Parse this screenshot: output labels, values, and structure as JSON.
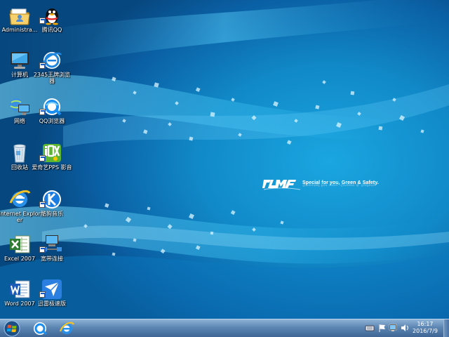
{
  "desktop": {
    "icons": [
      {
        "label": "Administra...",
        "icon": "user-folder-icon"
      },
      {
        "label": "腾讯QQ",
        "icon": "qq-penguin-icon"
      },
      {
        "label": "计算机",
        "icon": "computer-icon"
      },
      {
        "label": "2345王牌浏览器",
        "icon": "2345-browser-icon"
      },
      {
        "label": "网络",
        "icon": "network-icon"
      },
      {
        "label": "QQ浏览器",
        "icon": "qq-browser-icon"
      },
      {
        "label": "回收站",
        "icon": "recycle-bin-icon"
      },
      {
        "label": "爱奇艺PPS 影音",
        "icon": "iqiyi-pps-icon"
      },
      {
        "label": "Internet Explorer",
        "icon": "internet-explorer-icon"
      },
      {
        "label": "酷狗音乐",
        "icon": "kugou-music-icon"
      },
      {
        "label": "Excel 2007",
        "icon": "excel-icon"
      },
      {
        "label": "宽带连接",
        "icon": "broadband-connection-icon"
      },
      {
        "label": "Word 2007",
        "icon": "word-icon"
      },
      {
        "label": "迅雷极速版",
        "icon": "thunder-icon"
      }
    ]
  },
  "wallpaper": {
    "brand_text": "Special for you, Green & Safety."
  },
  "taskbar": {
    "pinned": [
      {
        "icon": "qq-browser-icon"
      },
      {
        "icon": "internet-explorer-icon"
      }
    ],
    "tray": [
      "keyboard-icon",
      "action-center-flag-icon",
      "network-tray-icon",
      "volume-icon"
    ],
    "clock": {
      "time": "16:17",
      "date": "2016/7/9"
    }
  },
  "colors": {
    "accent": "#1189c8",
    "taskbar": "#5d86b3"
  }
}
